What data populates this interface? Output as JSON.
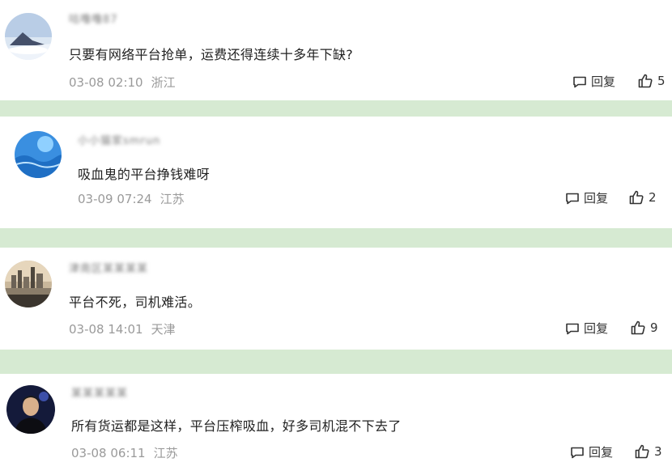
{
  "comments": [
    {
      "username": "咕噜噜87",
      "text": "只要有网络平台抢单，运费还得连续十多年下缺?",
      "time": "03-08 02:10",
      "location": "浙江",
      "reply_label": "回复",
      "likes": "5",
      "avatar_icon": "snow-mountain-avatar"
    },
    {
      "username": "小小猫家smrun",
      "text": "吸血鬼的平台挣钱难呀",
      "time": "03-09 07:24",
      "location": "江苏",
      "reply_label": "回复",
      "likes": "2",
      "avatar_icon": "blue-ocean-avatar"
    },
    {
      "username": "津南区某某某某",
      "text": "平台不死，司机难活。",
      "time": "03-08 14:01",
      "location": "天津",
      "reply_label": "回复",
      "likes": "9",
      "avatar_icon": "city-skyline-avatar"
    },
    {
      "username": "某某某某某",
      "text": "所有货运都是这样，平台压榨吸血，好多司机混不下去了",
      "time": "03-08 06:11",
      "location": "江苏",
      "reply_label": "回复",
      "likes": "3",
      "avatar_icon": "person-portrait-avatar"
    }
  ],
  "colors": {
    "divider": "#d6ead2",
    "meta_text": "#9a9a9a",
    "body_text": "#222222"
  }
}
